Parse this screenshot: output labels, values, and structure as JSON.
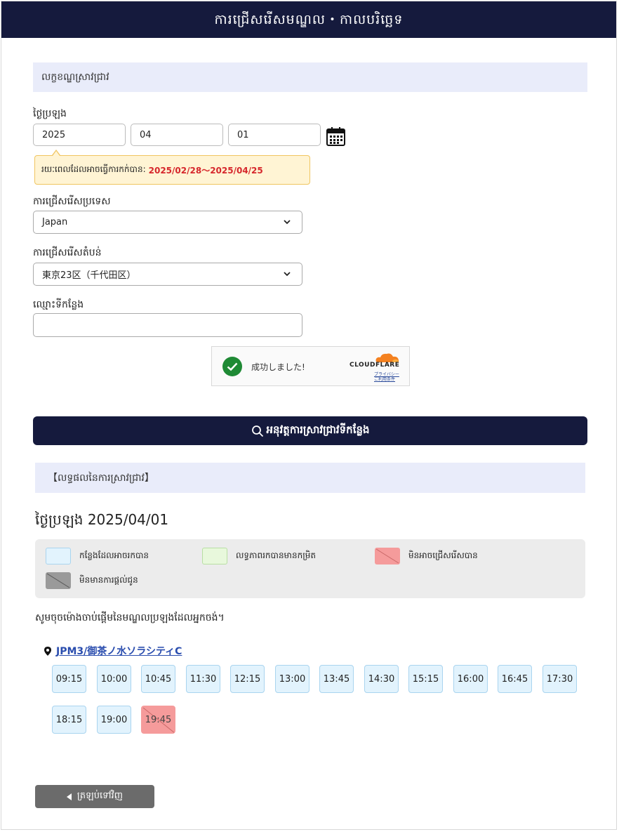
{
  "header": {
    "title": "ការជ្រើសរើសមណ្ឌល・កាលបរិច្ឆេទ"
  },
  "search_conditions": {
    "section_title": "លក្ខខណ្ឌស្រាវជ្រាវ",
    "exam_date_label": "ថ្ងៃប្រឡង",
    "year": "2025",
    "month": "04",
    "day": "01",
    "calendar_icon": "calendar-icon",
    "booking_period_label": "រយៈពេលដែលអាចធ្វើការកក់បាន:",
    "booking_period_range": "2025/02/28〜2025/04/25",
    "country_label": "ការជ្រើសរើសប្រទេស",
    "country_value": "Japan",
    "region_label": "ការជ្រើសរើសតំបន់",
    "region_value": "東京23区（千代田区）",
    "venue_name_label": "ឈ្មោះទីកន្លែង",
    "venue_name_value": ""
  },
  "captcha": {
    "status_text": "成功しました!",
    "brand": "CLOUDFLARE",
    "privacy_link": "プライバシー",
    "terms_link": "ご利用条件"
  },
  "search_button": {
    "label": "អនុវត្តការស្រាវជ្រាវទីកន្លែង",
    "icon": "search-icon"
  },
  "results": {
    "section_title": "【លទ្ធផលនៃការស្រាវជ្រាវ】",
    "date_line": "ថ្ងៃប្រឡង 2025/04/01",
    "legend": {
      "available": "កន្លែងដែលអាចរកបាន",
      "few_left": "លទ្ធភាពរកបានមានកម្រិត",
      "unselectable": "មិនអាចជ្រើសរើសបាន",
      "not_offered": "មិនមានការផ្តល់ជូន"
    },
    "instruction": "សូមចុចម៉ោងចាប់ផ្តើមនៃមណ្ឌលប្រឡងដែលអ្នកចង់។",
    "venue": {
      "icon": "map-pin-icon",
      "name": "JPM3/御茶ノ水ソラシティC"
    },
    "slots": [
      {
        "time": "09:15",
        "status": "available"
      },
      {
        "time": "10:00",
        "status": "available"
      },
      {
        "time": "10:45",
        "status": "available"
      },
      {
        "time": "11:30",
        "status": "available"
      },
      {
        "time": "12:15",
        "status": "available"
      },
      {
        "time": "13:00",
        "status": "available"
      },
      {
        "time": "13:45",
        "status": "available"
      },
      {
        "time": "14:30",
        "status": "available"
      },
      {
        "time": "15:15",
        "status": "available"
      },
      {
        "time": "16:00",
        "status": "available"
      },
      {
        "time": "16:45",
        "status": "available"
      },
      {
        "time": "17:30",
        "status": "available"
      },
      {
        "time": "18:15",
        "status": "available"
      },
      {
        "time": "19:00",
        "status": "available"
      },
      {
        "time": "19:45",
        "status": "unselectable"
      }
    ]
  },
  "back_button": {
    "label": "ត្រឡប់ទៅវិញ",
    "icon": "caret-left-icon"
  },
  "colors": {
    "header_bg": "#151a3d",
    "section_bg": "#e9ecfa",
    "slot_available": "#e2f3fd",
    "slot_few": "#e8f8dc",
    "slot_unselectable": "#f59b9b",
    "slot_not_offered": "#9a9a9a",
    "range_text": "#d6272c",
    "link": "#2a4dae"
  }
}
